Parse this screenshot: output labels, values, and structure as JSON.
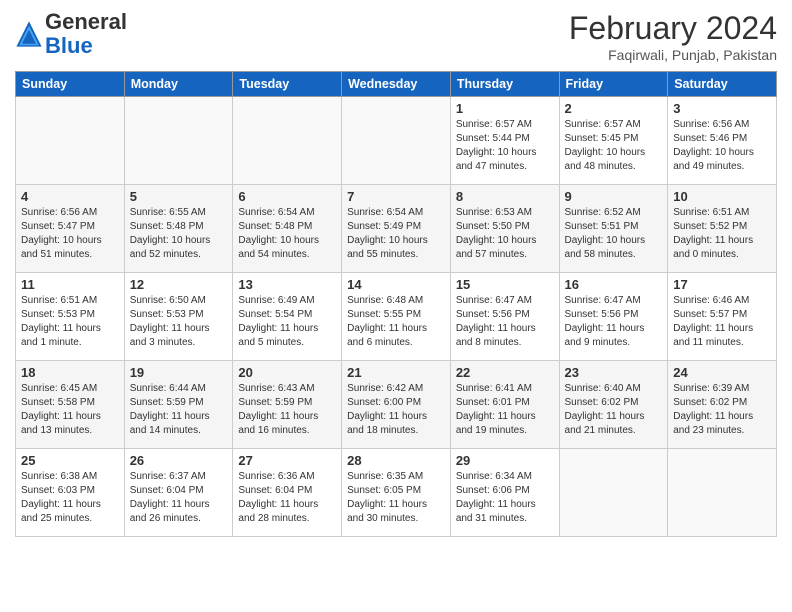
{
  "header": {
    "logo_general": "General",
    "logo_blue": "Blue",
    "month_title": "February 2024",
    "location": "Faqirwali, Punjab, Pakistan"
  },
  "days_of_week": [
    "Sunday",
    "Monday",
    "Tuesday",
    "Wednesday",
    "Thursday",
    "Friday",
    "Saturday"
  ],
  "weeks": [
    [
      {
        "date": "",
        "info": ""
      },
      {
        "date": "",
        "info": ""
      },
      {
        "date": "",
        "info": ""
      },
      {
        "date": "",
        "info": ""
      },
      {
        "date": "1",
        "info": "Sunrise: 6:57 AM\nSunset: 5:44 PM\nDaylight: 10 hours\nand 47 minutes."
      },
      {
        "date": "2",
        "info": "Sunrise: 6:57 AM\nSunset: 5:45 PM\nDaylight: 10 hours\nand 48 minutes."
      },
      {
        "date": "3",
        "info": "Sunrise: 6:56 AM\nSunset: 5:46 PM\nDaylight: 10 hours\nand 49 minutes."
      }
    ],
    [
      {
        "date": "4",
        "info": "Sunrise: 6:56 AM\nSunset: 5:47 PM\nDaylight: 10 hours\nand 51 minutes."
      },
      {
        "date": "5",
        "info": "Sunrise: 6:55 AM\nSunset: 5:48 PM\nDaylight: 10 hours\nand 52 minutes."
      },
      {
        "date": "6",
        "info": "Sunrise: 6:54 AM\nSunset: 5:48 PM\nDaylight: 10 hours\nand 54 minutes."
      },
      {
        "date": "7",
        "info": "Sunrise: 6:54 AM\nSunset: 5:49 PM\nDaylight: 10 hours\nand 55 minutes."
      },
      {
        "date": "8",
        "info": "Sunrise: 6:53 AM\nSunset: 5:50 PM\nDaylight: 10 hours\nand 57 minutes."
      },
      {
        "date": "9",
        "info": "Sunrise: 6:52 AM\nSunset: 5:51 PM\nDaylight: 10 hours\nand 58 minutes."
      },
      {
        "date": "10",
        "info": "Sunrise: 6:51 AM\nSunset: 5:52 PM\nDaylight: 11 hours\nand 0 minutes."
      }
    ],
    [
      {
        "date": "11",
        "info": "Sunrise: 6:51 AM\nSunset: 5:53 PM\nDaylight: 11 hours\nand 1 minute."
      },
      {
        "date": "12",
        "info": "Sunrise: 6:50 AM\nSunset: 5:53 PM\nDaylight: 11 hours\nand 3 minutes."
      },
      {
        "date": "13",
        "info": "Sunrise: 6:49 AM\nSunset: 5:54 PM\nDaylight: 11 hours\nand 5 minutes."
      },
      {
        "date": "14",
        "info": "Sunrise: 6:48 AM\nSunset: 5:55 PM\nDaylight: 11 hours\nand 6 minutes."
      },
      {
        "date": "15",
        "info": "Sunrise: 6:47 AM\nSunset: 5:56 PM\nDaylight: 11 hours\nand 8 minutes."
      },
      {
        "date": "16",
        "info": "Sunrise: 6:47 AM\nSunset: 5:56 PM\nDaylight: 11 hours\nand 9 minutes."
      },
      {
        "date": "17",
        "info": "Sunrise: 6:46 AM\nSunset: 5:57 PM\nDaylight: 11 hours\nand 11 minutes."
      }
    ],
    [
      {
        "date": "18",
        "info": "Sunrise: 6:45 AM\nSunset: 5:58 PM\nDaylight: 11 hours\nand 13 minutes."
      },
      {
        "date": "19",
        "info": "Sunrise: 6:44 AM\nSunset: 5:59 PM\nDaylight: 11 hours\nand 14 minutes."
      },
      {
        "date": "20",
        "info": "Sunrise: 6:43 AM\nSunset: 5:59 PM\nDaylight: 11 hours\nand 16 minutes."
      },
      {
        "date": "21",
        "info": "Sunrise: 6:42 AM\nSunset: 6:00 PM\nDaylight: 11 hours\nand 18 minutes."
      },
      {
        "date": "22",
        "info": "Sunrise: 6:41 AM\nSunset: 6:01 PM\nDaylight: 11 hours\nand 19 minutes."
      },
      {
        "date": "23",
        "info": "Sunrise: 6:40 AM\nSunset: 6:02 PM\nDaylight: 11 hours\nand 21 minutes."
      },
      {
        "date": "24",
        "info": "Sunrise: 6:39 AM\nSunset: 6:02 PM\nDaylight: 11 hours\nand 23 minutes."
      }
    ],
    [
      {
        "date": "25",
        "info": "Sunrise: 6:38 AM\nSunset: 6:03 PM\nDaylight: 11 hours\nand 25 minutes."
      },
      {
        "date": "26",
        "info": "Sunrise: 6:37 AM\nSunset: 6:04 PM\nDaylight: 11 hours\nand 26 minutes."
      },
      {
        "date": "27",
        "info": "Sunrise: 6:36 AM\nSunset: 6:04 PM\nDaylight: 11 hours\nand 28 minutes."
      },
      {
        "date": "28",
        "info": "Sunrise: 6:35 AM\nSunset: 6:05 PM\nDaylight: 11 hours\nand 30 minutes."
      },
      {
        "date": "29",
        "info": "Sunrise: 6:34 AM\nSunset: 6:06 PM\nDaylight: 11 hours\nand 31 minutes."
      },
      {
        "date": "",
        "info": ""
      },
      {
        "date": "",
        "info": ""
      }
    ]
  ]
}
